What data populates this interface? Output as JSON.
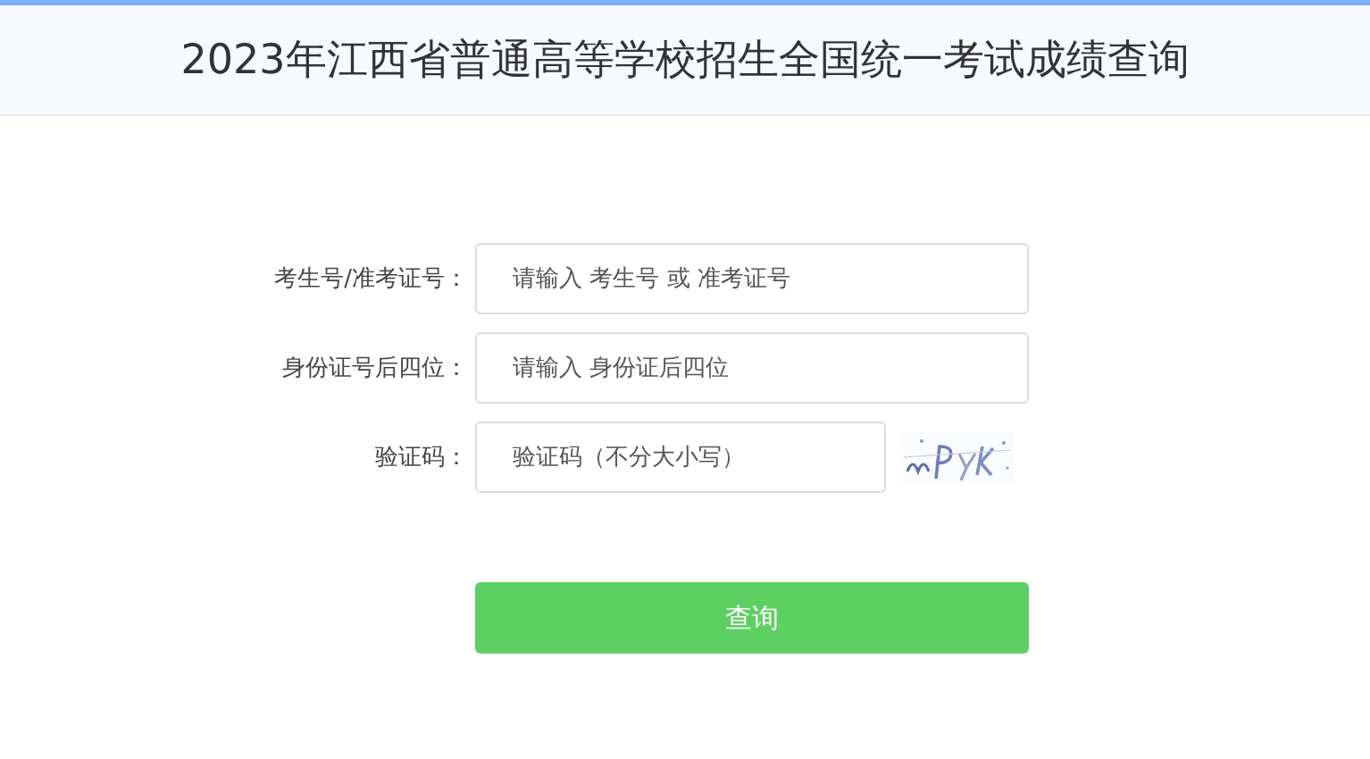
{
  "header": {
    "title": "2023年江西省普通高等学校招生全国统一考试成绩查询"
  },
  "form": {
    "fields": [
      {
        "kind": "text",
        "label": "考生号/准考证号：",
        "placeholder": "请输入 考生号 或 准考证号"
      },
      {
        "kind": "text",
        "label": "身份证号后四位：",
        "placeholder": "请输入 身份证后四位"
      },
      {
        "kind": "captcha",
        "label": "验证码：",
        "placeholder": "验证码（不分大小写）"
      }
    ],
    "submit": "查询"
  }
}
